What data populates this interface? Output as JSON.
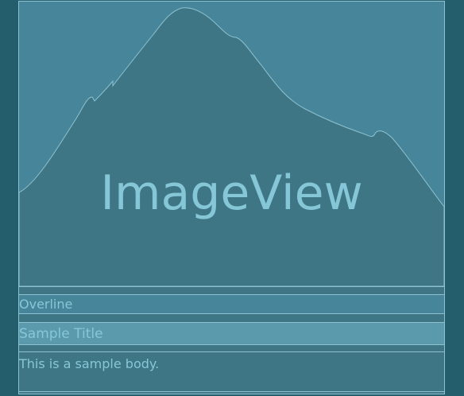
{
  "image_view": {
    "label": "ImageView"
  },
  "text_block": {
    "overline": "Overline",
    "title": "Sample Title",
    "body": "This is a sample body."
  },
  "colors": {
    "background": "#245d6c",
    "card": "#3e7686",
    "overline_band": "#47859a",
    "title_band": "#5b9aac",
    "text": "#86c7d7",
    "outline": "#8dc1cf"
  }
}
